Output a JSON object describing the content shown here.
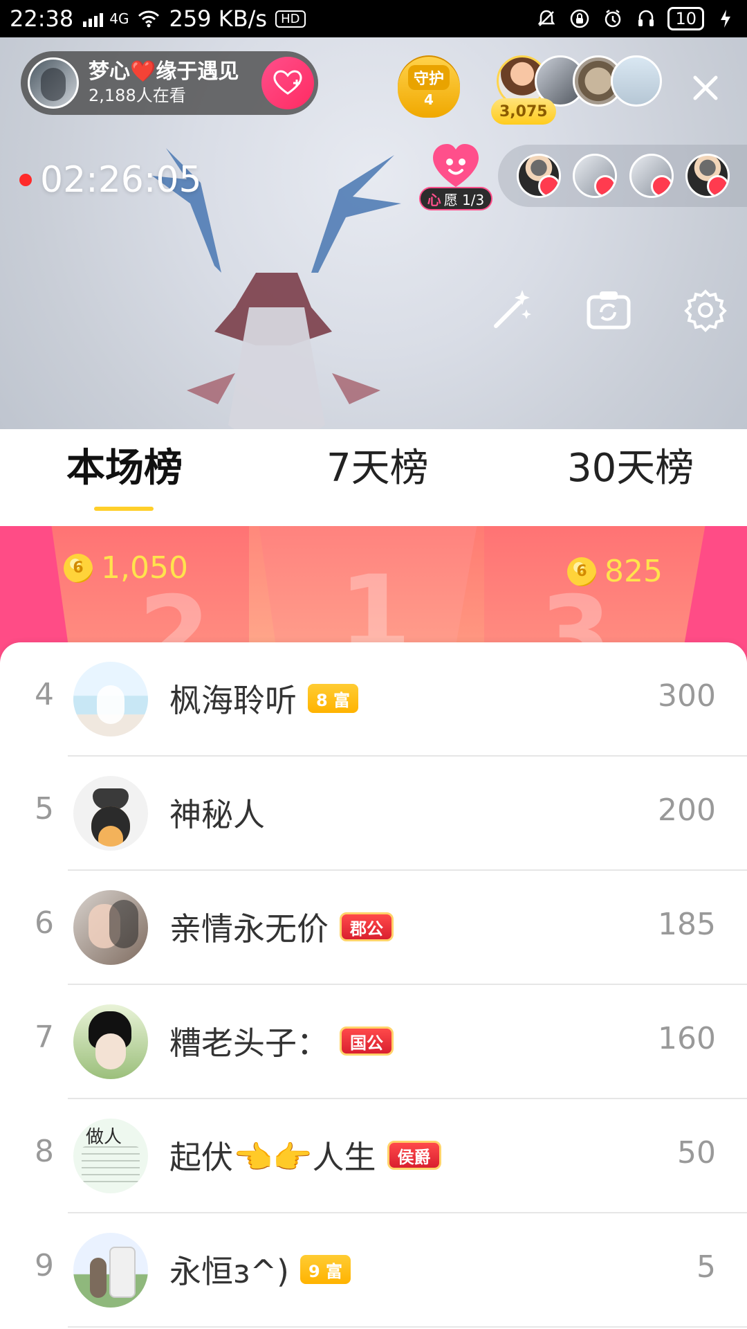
{
  "status_bar": {
    "time": "22:38",
    "network_label": "4G",
    "speed": "259 KB/s",
    "hd_label": "HD",
    "battery_level": "10"
  },
  "live": {
    "host_name": "梦心❤️缘于遇见",
    "viewers_text": "2,188人在看",
    "guard_title": "守护",
    "guard_count": "4",
    "top_viewer_coins": "3,075",
    "live_timer": "02:26:05",
    "wish_label_prefix": "心",
    "wish_label_text": "愿 1/3"
  },
  "tabs": [
    {
      "label": "本场榜",
      "active": true
    },
    {
      "label": "7天榜",
      "active": false
    },
    {
      "label": "30天榜",
      "active": false
    }
  ],
  "podium": {
    "left_value": "1,050",
    "right_value": "825",
    "left_rank": "2",
    "center_rank": "1",
    "right_rank": "3"
  },
  "leaderboard": [
    {
      "rank": "4",
      "name": "枫海聆听",
      "badge_type": "rich",
      "badge": "8 富",
      "score": "300",
      "avatar": "beach-couple"
    },
    {
      "rank": "5",
      "name": "神秘人",
      "badge_type": "",
      "badge": "",
      "score": "200",
      "avatar": "mystery-spy"
    },
    {
      "rank": "6",
      "name": "亲情永无价",
      "badge_type": "noble",
      "badge": "郡公",
      "score": "185",
      "avatar": "kissing-couple"
    },
    {
      "rank": "7",
      "name": "糟老头子：",
      "badge_type": "noble",
      "badge": "国公",
      "score": "160",
      "avatar": "anime-boy"
    },
    {
      "rank": "8",
      "name": "起伏👈👉人生",
      "badge_type": "noble",
      "badge": "侯爵",
      "score": "50",
      "avatar": "text-poster",
      "avatar_text": "做人"
    },
    {
      "rank": "9",
      "name": "永恒з^)",
      "badge_type": "rich",
      "badge": "9 富",
      "score": "5",
      "avatar": "stone-marker"
    }
  ],
  "colors": {
    "accent_yellow": "#ffcf2a",
    "podium_pink": "#ff4c86",
    "follow_pink": "#ff2b62",
    "text_gray": "#999999"
  },
  "icons": {
    "signal": "signal-icon",
    "wifi": "wifi-icon",
    "follow": "heart-plus-icon",
    "close": "close-icon",
    "magic": "magic-wand-icon",
    "camera": "flip-camera-icon",
    "settings": "gear-icon"
  }
}
